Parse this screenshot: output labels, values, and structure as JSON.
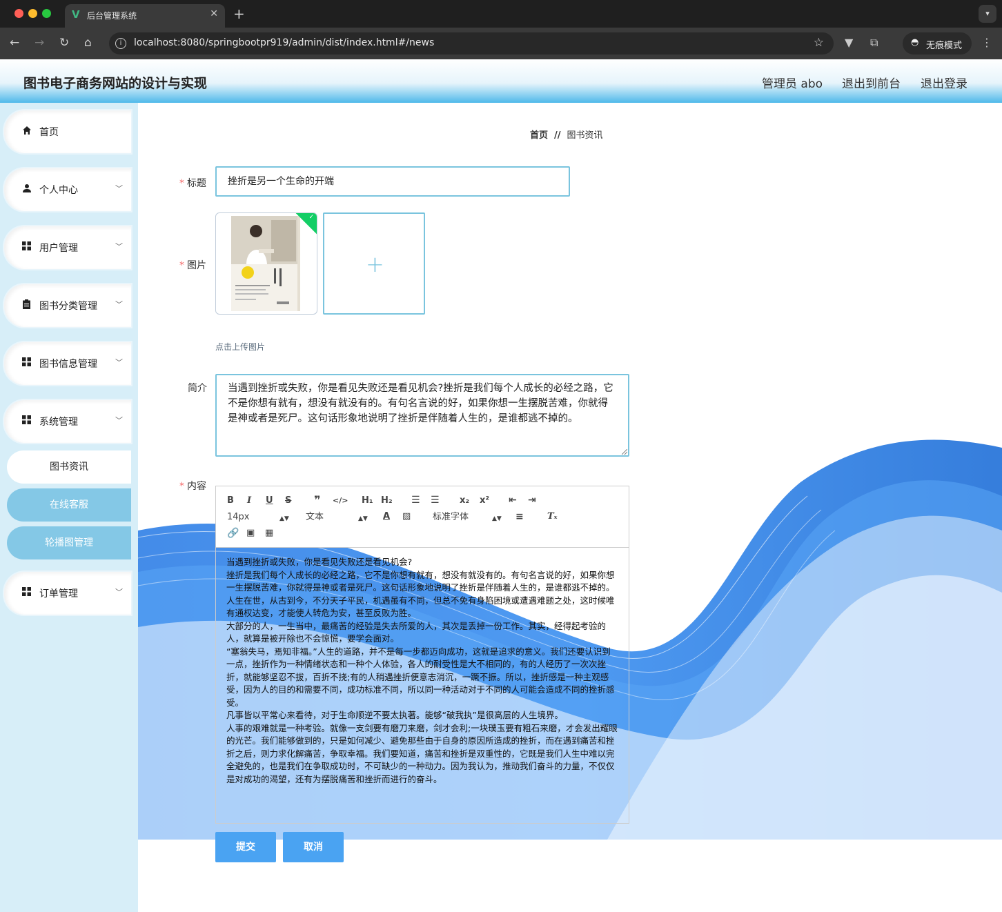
{
  "browser": {
    "tab_title": "后台管理系统",
    "url": "localhost:8080/springbootpr919/admin/dist/index.html#/news",
    "incognito_label": "无痕模式"
  },
  "header": {
    "title": "图书电子商务网站的设计与实现",
    "user_label": "管理员 abo",
    "to_front_label": "退出到前台",
    "logout_label": "退出登录"
  },
  "sidebar": {
    "items": [
      {
        "label": "首页"
      },
      {
        "label": "个人中心"
      },
      {
        "label": "用户管理"
      },
      {
        "label": "图书分类管理"
      },
      {
        "label": "图书信息管理"
      },
      {
        "label": "系统管理"
      }
    ],
    "sub_items": [
      {
        "label": "图书资讯"
      },
      {
        "label": "在线客服"
      },
      {
        "label": "轮播图管理"
      }
    ],
    "last_item": {
      "label": "订单管理"
    }
  },
  "breadcrumb": {
    "home": "首页",
    "separator": "//",
    "current": "图书资讯"
  },
  "form": {
    "title_label": "标题",
    "title_value": "挫折是另一个生命的开端",
    "image_label": "图片",
    "upload_tip": "点击上传图片",
    "intro_label": "简介",
    "intro_value": "当遇到挫折或失败，你是看见失败还是看见机会?挫折是我们每个人成长的必经之路，它不是你想有就有，想没有就没有的。有句名言说的好，如果你想一生摆脱苦难，你就得是神或者是死尸。这句话形象地说明了挫折是伴随着人生的，是谁都逃不掉的。",
    "content_label": "内容",
    "submit_label": "提交",
    "cancel_label": "取消"
  },
  "editor": {
    "font_size": "14px",
    "block_type": "文本",
    "font_family": "标准字体",
    "paragraphs": [
      "当遇到挫折或失败，你是看见失败还是看见机会?",
      "挫折是我们每个人成长的必经之路，它不是你想有就有，想没有就没有的。有句名言说的好，如果你想一生摆脱苦难，你就得是神或者是死尸。这句话形象地说明了挫折是伴随着人生的，是谁都逃不掉的。",
      "人生在世，从古到今，不分天子平民，机遇虽有不同，但总不免有身陷困境或遭遇难题之处，这时候唯有通权达变，才能使人转危为安，甚至反败为胜。",
      "大部分的人，一生当中，最痛苦的经验是失去所爱的人，其次是丢掉一份工作。其实，经得起考验的人，就算是被开除也不会惊慌，要学会面对。",
      "“塞翁失马，焉知非福。”人生的道路，并不是每一步都迈向成功，这就是追求的意义。我们还要认识到一点，挫折作为一种情绪状态和一种个人体验，各人的耐受性是大不相同的，有的人经历了一次次挫折，就能够坚忍不拔，百折不挠;有的人稍遇挫折便意志消沉，一蹶不振。所以，挫折感是一种主观感受，因为人的目的和需要不同，成功标准不同，所以同一种活动对于不同的人可能会造成不同的挫折感受。",
      "凡事皆以平常心来看待，对于生命顺逆不要太执著。能够“破我执”是很高层的人生境界。",
      "人事的艰难就是一种考验。就像一支剑要有磨刀来磨，剑才会利;一块璞玉要有粗石来磨，才会发出耀眼的光芒。我们能够做到的，只是如何减少、避免那些由于自身的原因所造成的挫折，而在遇到痛苦和挫折之后，则力求化解痛苦，争取幸福。我们要知道，痛苦和挫折是双重性的，它既是我们人生中难以完全避免的，也是我们在争取成功时，不可缺少的一种动力。因为我认为，推动我们奋斗的力量，不仅仅是对成功的渴望，还有为摆脱痛苦和挫折而进行的奋斗。"
    ]
  },
  "colors": {
    "accent": "#7ac4de",
    "button": "#4aa3f2",
    "sidebar_bg": "#d7eef8",
    "active_sub": "#84c8e6",
    "required": "#f56c6c"
  }
}
